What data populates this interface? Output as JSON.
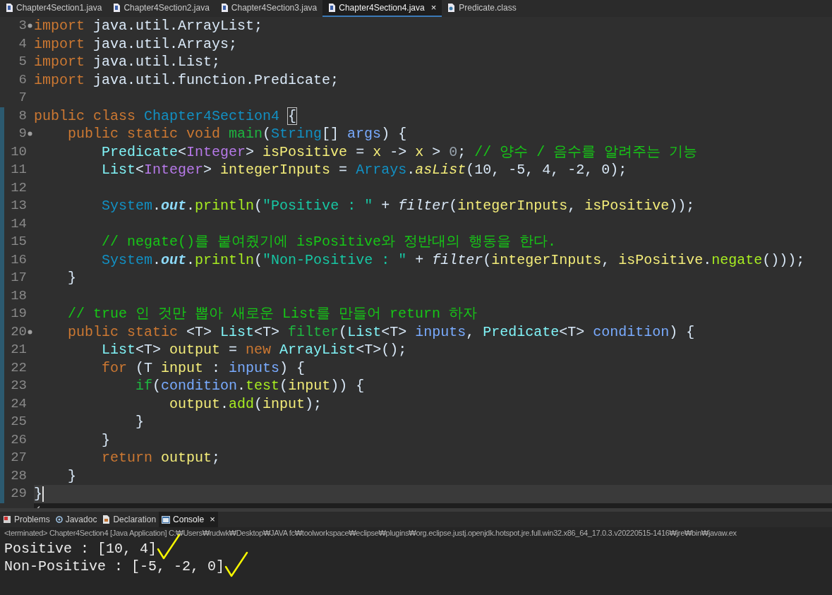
{
  "editor_tabs": [
    {
      "label": "Chapter4Section1.java",
      "selected": false,
      "closable": false,
      "kind": "java"
    },
    {
      "label": "Chapter4Section2.java",
      "selected": false,
      "closable": false,
      "kind": "java"
    },
    {
      "label": "Chapter4Section3.java",
      "selected": false,
      "closable": false,
      "kind": "java"
    },
    {
      "label": "Chapter4Section4.java",
      "selected": true,
      "closable": true,
      "close": "×",
      "kind": "java"
    },
    {
      "label": "Predicate.class",
      "selected": false,
      "closable": false,
      "kind": "class"
    }
  ],
  "code_lines": [
    {
      "number": "3",
      "fold": true,
      "current": false,
      "tokens": [
        {
          "text": "import",
          "kind": "keyword"
        },
        {
          "text": " java.util.ArrayList;",
          "kind": "plain"
        }
      ]
    },
    {
      "number": "4",
      "fold": false,
      "current": false,
      "tokens": [
        {
          "text": "import",
          "kind": "keyword"
        },
        {
          "text": " java.util.Arrays;",
          "kind": "plain"
        }
      ]
    },
    {
      "number": "5",
      "fold": false,
      "current": false,
      "tokens": [
        {
          "text": "import",
          "kind": "keyword"
        },
        {
          "text": " java.util.List;",
          "kind": "plain"
        }
      ]
    },
    {
      "number": "6",
      "fold": false,
      "current": false,
      "tokens": [
        {
          "text": "import",
          "kind": "keyword"
        },
        {
          "text": " java.util.function.Predicate;",
          "kind": "plain"
        }
      ]
    },
    {
      "number": "7",
      "fold": false,
      "current": false
    },
    {
      "number": "8",
      "fold": false,
      "current": false,
      "tokens": [
        {
          "text": "public class ",
          "kind": "keyword"
        },
        {
          "text": "Chapter4Section4 ",
          "kind": "class"
        },
        {
          "text": "{",
          "kind": "bracket_match"
        }
      ]
    },
    {
      "number": "9",
      "fold": true,
      "current": false,
      "tokens": [
        {
          "text": "    public static void ",
          "kind": "keyword"
        },
        {
          "text": "main",
          "kind": "method_decl"
        },
        {
          "text": "(",
          "kind": "plain"
        },
        {
          "text": "String",
          "kind": "class"
        },
        {
          "text": "[] ",
          "kind": "plain"
        },
        {
          "text": "args",
          "kind": "param"
        },
        {
          "text": ") {",
          "kind": "plain"
        }
      ]
    },
    {
      "number": "10",
      "fold": false,
      "current": false,
      "tokens": [
        {
          "text": "        Predicate",
          "kind": "type"
        },
        {
          "text": "<",
          "kind": "plain"
        },
        {
          "text": "Integer",
          "kind": "typearg"
        },
        {
          "text": "> ",
          "kind": "plain"
        },
        {
          "text": "isPositive",
          "kind": "local"
        },
        {
          "text": " = ",
          "kind": "plain"
        },
        {
          "text": "x",
          "kind": "local"
        },
        {
          "text": " -> ",
          "kind": "plain"
        },
        {
          "text": "x",
          "kind": "local"
        },
        {
          "text": " > ",
          "kind": "plain"
        },
        {
          "text": "0",
          "kind": "number"
        },
        {
          "text": "; ",
          "kind": "plain"
        },
        {
          "text": "// 양수 / 음수를 알려주는 기능",
          "kind": "comment"
        }
      ]
    },
    {
      "number": "11",
      "fold": false,
      "current": false,
      "tokens": [
        {
          "text": "        List",
          "kind": "type"
        },
        {
          "text": "<",
          "kind": "plain"
        },
        {
          "text": "Integer",
          "kind": "typearg"
        },
        {
          "text": "> ",
          "kind": "plain"
        },
        {
          "text": "integerInputs",
          "kind": "local"
        },
        {
          "text": " = ",
          "kind": "plain"
        },
        {
          "text": "Arrays",
          "kind": "class"
        },
        {
          "text": ".",
          "kind": "plain"
        },
        {
          "text": "asList",
          "kind": "static_method"
        },
        {
          "text": "(10, -5, 4, -2, 0);",
          "kind": "plain"
        }
      ]
    },
    {
      "number": "12",
      "fold": false,
      "current": false
    },
    {
      "number": "13",
      "fold": false,
      "current": false,
      "tokens": [
        {
          "text": "        System",
          "kind": "class"
        },
        {
          "text": ".",
          "kind": "plain"
        },
        {
          "text": "out",
          "kind": "static_field"
        },
        {
          "text": ".",
          "kind": "plain"
        },
        {
          "text": "println",
          "kind": "method"
        },
        {
          "text": "(",
          "kind": "plain"
        },
        {
          "text": "\"Positive : \"",
          "kind": "string"
        },
        {
          "text": " + ",
          "kind": "plain"
        },
        {
          "text": "filter",
          "kind": "static_call"
        },
        {
          "text": "(",
          "kind": "plain"
        },
        {
          "text": "integerInputs",
          "kind": "local"
        },
        {
          "text": ", ",
          "kind": "plain"
        },
        {
          "text": "isPositive",
          "kind": "local"
        },
        {
          "text": "));",
          "kind": "plain"
        }
      ]
    },
    {
      "number": "14",
      "fold": false,
      "current": false
    },
    {
      "number": "15",
      "fold": false,
      "current": false,
      "tokens": [
        {
          "text": "        // negate()를 붙여줬기에 isPositive와 정반대의 행동을 한다.",
          "kind": "comment"
        }
      ]
    },
    {
      "number": "16",
      "fold": false,
      "current": false,
      "tokens": [
        {
          "text": "        System",
          "kind": "class"
        },
        {
          "text": ".",
          "kind": "plain"
        },
        {
          "text": "out",
          "kind": "static_field"
        },
        {
          "text": ".",
          "kind": "plain"
        },
        {
          "text": "println",
          "kind": "method"
        },
        {
          "text": "(",
          "kind": "plain"
        },
        {
          "text": "\"Non-Positive : \"",
          "kind": "string"
        },
        {
          "text": " + ",
          "kind": "plain"
        },
        {
          "text": "filter",
          "kind": "static_call"
        },
        {
          "text": "(",
          "kind": "plain"
        },
        {
          "text": "integerInputs",
          "kind": "local"
        },
        {
          "text": ", ",
          "kind": "plain"
        },
        {
          "text": "isPositive",
          "kind": "local"
        },
        {
          "text": ".",
          "kind": "plain"
        },
        {
          "text": "negate",
          "kind": "method"
        },
        {
          "text": "()));",
          "kind": "plain"
        }
      ]
    },
    {
      "number": "17",
      "fold": false,
      "current": false,
      "tokens": [
        {
          "text": "    }",
          "kind": "plain"
        }
      ]
    },
    {
      "number": "18",
      "fold": false,
      "current": false
    },
    {
      "number": "19",
      "fold": false,
      "current": false,
      "tokens": [
        {
          "text": "    // true 인 것만 뽑아 새로운 List를 만들어 return 하자",
          "kind": "comment"
        }
      ]
    },
    {
      "number": "20",
      "fold": true,
      "current": false,
      "tokens": [
        {
          "text": "    public static ",
          "kind": "keyword"
        },
        {
          "text": "<T> ",
          "kind": "plain"
        },
        {
          "text": "List",
          "kind": "type"
        },
        {
          "text": "<T> ",
          "kind": "plain"
        },
        {
          "text": "filter",
          "kind": "method_decl"
        },
        {
          "text": "(",
          "kind": "plain"
        },
        {
          "text": "List",
          "kind": "type"
        },
        {
          "text": "<T> ",
          "kind": "plain"
        },
        {
          "text": "inputs",
          "kind": "param"
        },
        {
          "text": ", ",
          "kind": "plain"
        },
        {
          "text": "Predicate",
          "kind": "type"
        },
        {
          "text": "<T> ",
          "kind": "plain"
        },
        {
          "text": "condition",
          "kind": "param"
        },
        {
          "text": ") {",
          "kind": "plain"
        }
      ]
    },
    {
      "number": "21",
      "fold": false,
      "current": false,
      "tokens": [
        {
          "text": "        List",
          "kind": "type"
        },
        {
          "text": "<T> ",
          "kind": "plain"
        },
        {
          "text": "output",
          "kind": "local"
        },
        {
          "text": " = ",
          "kind": "plain"
        },
        {
          "text": "new ",
          "kind": "keyword"
        },
        {
          "text": "ArrayList",
          "kind": "type"
        },
        {
          "text": "<T>();",
          "kind": "plain"
        }
      ]
    },
    {
      "number": "22",
      "fold": false,
      "current": false,
      "tokens": [
        {
          "text": "        for",
          "kind": "keyword"
        },
        {
          "text": " (T ",
          "kind": "plain"
        },
        {
          "text": "input",
          "kind": "local"
        },
        {
          "text": " : ",
          "kind": "plain"
        },
        {
          "text": "inputs",
          "kind": "param"
        },
        {
          "text": ") {",
          "kind": "plain"
        }
      ]
    },
    {
      "number": "23",
      "fold": false,
      "current": false,
      "tokens": [
        {
          "text": "            if",
          "kind": "method_decl"
        },
        {
          "text": "(",
          "kind": "plain"
        },
        {
          "text": "condition",
          "kind": "param"
        },
        {
          "text": ".",
          "kind": "plain"
        },
        {
          "text": "test",
          "kind": "method"
        },
        {
          "text": "(",
          "kind": "plain"
        },
        {
          "text": "input",
          "kind": "local"
        },
        {
          "text": ")) {",
          "kind": "plain"
        }
      ]
    },
    {
      "number": "24",
      "fold": false,
      "current": false,
      "tokens": [
        {
          "text": "                output",
          "kind": "local"
        },
        {
          "text": ".",
          "kind": "plain"
        },
        {
          "text": "add",
          "kind": "method"
        },
        {
          "text": "(",
          "kind": "plain"
        },
        {
          "text": "input",
          "kind": "local"
        },
        {
          "text": ");",
          "kind": "plain"
        }
      ]
    },
    {
      "number": "25",
      "fold": false,
      "current": false,
      "tokens": [
        {
          "text": "            }",
          "kind": "plain"
        }
      ]
    },
    {
      "number": "26",
      "fold": false,
      "current": false,
      "tokens": [
        {
          "text": "        }",
          "kind": "plain"
        }
      ]
    },
    {
      "number": "27",
      "fold": false,
      "current": false,
      "tokens": [
        {
          "text": "        return ",
          "kind": "keyword"
        },
        {
          "text": "output",
          "kind": "local"
        },
        {
          "text": ";",
          "kind": "plain"
        }
      ]
    },
    {
      "number": "28",
      "fold": false,
      "current": false,
      "tokens": [
        {
          "text": "    }",
          "kind": "plain"
        }
      ]
    },
    {
      "number": "29",
      "fold": false,
      "current": true,
      "tokens": [
        {
          "text": "}",
          "kind": "plain"
        }
      ]
    }
  ],
  "panel_tabs": [
    {
      "label": "Problems",
      "selected": false,
      "closable": false,
      "kind": "problems"
    },
    {
      "label": "Javadoc",
      "selected": false,
      "closable": false,
      "kind": "javadoc"
    },
    {
      "label": "Declaration",
      "selected": false,
      "closable": false,
      "kind": "declaration"
    },
    {
      "label": "Console",
      "selected": true,
      "closable": true,
      "close": "×",
      "kind": "console"
    }
  ],
  "console": {
    "header": "<terminated> Chapter4Section4 [Java Application] C:₩Users₩rudwk₩Desktop₩JAVA fc₩toolworkspace₩eclipse₩plugins₩org.eclipse.justj.openjdk.hotspot.jre.full.win32.x86_64_17.0.3.v20220515-1416₩jre₩bin₩javaw.ex",
    "output": [
      {
        "text": "Positive : [10, 4]",
        "checked": true
      },
      {
        "text": "Non-Positive : [-5, -2, 0]",
        "checked": true
      }
    ]
  }
}
